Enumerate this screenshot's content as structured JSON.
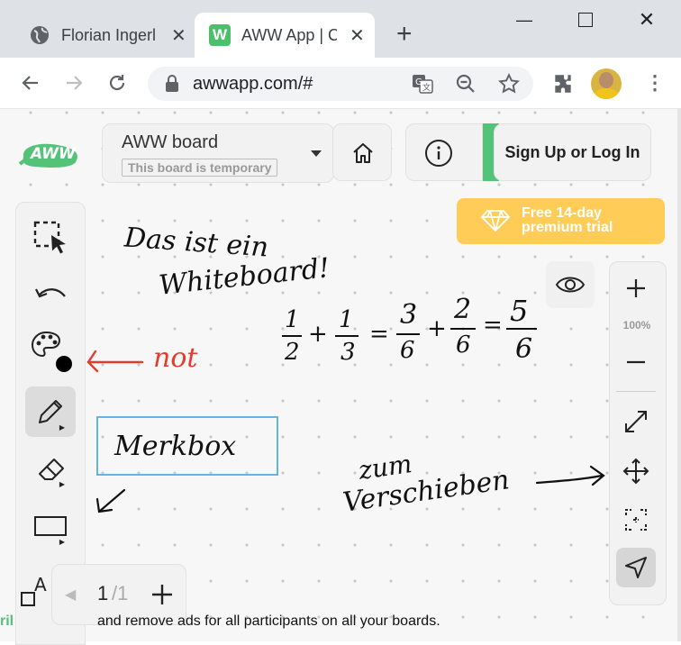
{
  "browser": {
    "tabs": [
      {
        "title": "Florian Ingerl",
        "icon": "globe-icon"
      },
      {
        "title": "AWW App | C",
        "icon": "aww-favicon-icon"
      }
    ],
    "new_tab": "+",
    "url": "awwapp.com/#"
  },
  "app": {
    "logo": "AWW",
    "board_title": "AWW board",
    "board_subtitle": "This board is temporary",
    "sign_in": "Sign Up or Log In",
    "premium": {
      "line1": "Free 14-day",
      "line2": "premium trial"
    },
    "zoom": "100%",
    "page_current": "1",
    "page_total": "/1",
    "footer_left": "ril",
    "footer_text": "and remove ads for all participants on all your boards.",
    "colors": {
      "accent": "#55c27a",
      "premium": "#ffcd57",
      "selection": "#66b3e0",
      "red_ink": "#e53b2c"
    }
  },
  "canvas": {
    "text1": "Das ist ein",
    "text2": "Whiteboard!",
    "math": {
      "a_num": "1",
      "a_den": "2",
      "plus1": "+",
      "b_num": "1",
      "b_den": "3",
      "eq1": "=",
      "c_num": "3",
      "c_den": "6",
      "plus2": "+",
      "d_num": "2",
      "d_den": "6",
      "eq2": "=",
      "e_num": "5",
      "e_den": "6"
    },
    "not_label": "not",
    "box_label": "Merkbox",
    "move1": "zum",
    "move2": "Verschieben"
  }
}
